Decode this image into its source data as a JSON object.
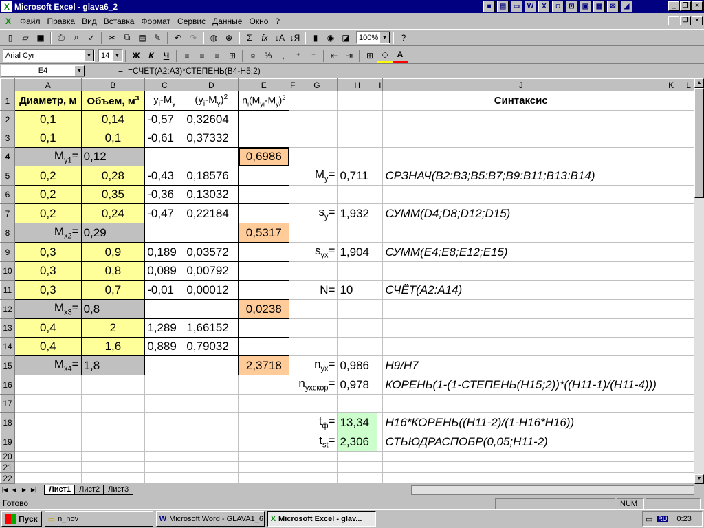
{
  "window": {
    "title": "Microsoft Excel - glava6_2",
    "app_icon": "excel-x-icon"
  },
  "menu": [
    "Файл",
    "Правка",
    "Вид",
    "Вставка",
    "Формат",
    "Сервис",
    "Данные",
    "Окно",
    "?"
  ],
  "toolbar": {
    "zoom": "100%",
    "font": "Arial Cyr",
    "size": "14"
  },
  "formula_bar": {
    "cell": "E4",
    "eq": "=",
    "formula": "=СЧЁТ(A2:A3)*СТЕПЕНЬ(B4-H5;2)"
  },
  "columns": [
    "A",
    "B",
    "C",
    "D",
    "E",
    "F",
    "G",
    "H",
    "I",
    "J",
    "K",
    "L"
  ],
  "rows": [
    {
      "n": "1",
      "A": "Диаметр, м",
      "B": "Объем, м",
      "B_sup": "3",
      "C": "y",
      "C_sub": "i",
      "C2": "-M",
      "C2_sub": "y",
      "D": "(y",
      "D_sub": "i",
      "D2": "-M",
      "D2_sub": "y",
      "D3": ")",
      "D_sup": "2",
      "E": "n",
      "E_sub": "i",
      "E2": "(M",
      "E2_sub": "yi",
      "E3": "-M",
      "E3_sub": "y",
      "E4": ")",
      "E_sup": "2",
      "J": "Синтаксис"
    },
    {
      "n": "2",
      "A": "0,1",
      "B": "0,14",
      "C": "-0,57",
      "D": "0,32604"
    },
    {
      "n": "3",
      "A": "0,1",
      "B": "0,1",
      "C": "-0,61",
      "D": "0,37332"
    },
    {
      "n": "4",
      "A": "M",
      "A_sub": "y1",
      "A2": "=",
      "B": "0,12",
      "E": "0,6986"
    },
    {
      "n": "5",
      "A": "0,2",
      "B": "0,28",
      "C": "-0,43",
      "D": "0,18576",
      "G": "M",
      "G_sub": "y",
      "G2": "=",
      "H": "0,711",
      "J": "СРЗНАЧ(B2:B3;B5:B7;B9:B11;B13:B14)"
    },
    {
      "n": "6",
      "A": "0,2",
      "B": "0,35",
      "C": "-0,36",
      "D": "0,13032"
    },
    {
      "n": "7",
      "A": "0,2",
      "B": "0,24",
      "C": "-0,47",
      "D": "0,22184",
      "G": "s",
      "G_sub": "y",
      "G2": "=",
      "H": "1,932",
      "J": "СУММ(D4;D8;D12;D15)"
    },
    {
      "n": "8",
      "A": "M",
      "A_sub": "x2",
      "A2": "=",
      "B": "0,29",
      "E": "0,5317"
    },
    {
      "n": "9",
      "A": "0,3",
      "B": "0,9",
      "C": "0,189",
      "D": "0,03572",
      "G": "s",
      "G_sub": "yx",
      "G2": "=",
      "H": "1,904",
      "J": "СУММ(E4;E8;E12;E15)"
    },
    {
      "n": "10",
      "A": "0,3",
      "B": "0,8",
      "C": "0,089",
      "D": "0,00792"
    },
    {
      "n": "11",
      "A": "0,3",
      "B": "0,7",
      "C": "-0,01",
      "D": "0,00012",
      "G": "N",
      "G2": "=",
      "H": "10",
      "J": "СЧЁТ(A2:A14)"
    },
    {
      "n": "12",
      "A": "M",
      "A_sub": "x3",
      "A2": "=",
      "B": "0,8",
      "E": "0,0238"
    },
    {
      "n": "13",
      "A": "0,4",
      "B": "2",
      "C": "1,289",
      "D": "1,66152"
    },
    {
      "n": "14",
      "A": "0,4",
      "B": "1,6",
      "C": "0,889",
      "D": "0,79032"
    },
    {
      "n": "15",
      "A": "M",
      "A_sub": "x4",
      "A2": "=",
      "B": "1,8",
      "E": "2,3718",
      "G": "n",
      "G_sub": "yx",
      "G2": "=",
      "H": "0,986",
      "J": "H9/H7"
    },
    {
      "n": "16",
      "G": "n",
      "G_sub": "yxскор",
      "G2": "=",
      "H": "0,978",
      "J": "КОРЕНЬ(1-(1-СТЕПЕНЬ(H15;2))*((H11-1)/(H11-4)))"
    },
    {
      "n": "17"
    },
    {
      "n": "18",
      "G": "t",
      "G_sub": "ф",
      "G2": "=",
      "H": "13,34",
      "J": "H16*КОРЕНЬ((H11-2)/(1-H16*H16))"
    },
    {
      "n": "19",
      "G": "t",
      "G_sub": "st",
      "G2": "=",
      "H": "2,306",
      "J": "СТЬЮДРАСПОБР(0,05;H11-2)"
    },
    {
      "n": "20"
    },
    {
      "n": "21"
    },
    {
      "n": "22"
    }
  ],
  "sheets": [
    "Лист1",
    "Лист2",
    "Лист3"
  ],
  "status": {
    "text": "Готово",
    "num": "NUM"
  },
  "taskbar": {
    "start": "Пуск",
    "tasks": [
      "n_nov",
      "Microsoft Word - GLAVA1_6",
      "Microsoft Excel - glav..."
    ],
    "lang": "RU",
    "clock": "0:23"
  }
}
